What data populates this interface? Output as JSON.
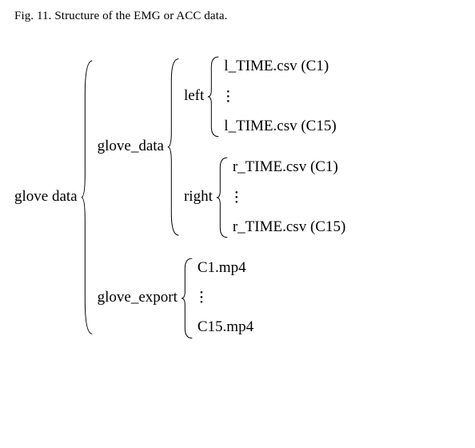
{
  "caption": "Fig. 11.   Structure of the EMG or ACC data.",
  "root": "glove data",
  "branch1": {
    "label": "glove_data",
    "left": {
      "label": "left",
      "first": "l_TIME.csv (C1)",
      "last": "l_TIME.csv (C15)"
    },
    "right": {
      "label": "right",
      "first": "r_TIME.csv (C1)",
      "last": "r_TIME.csv (C15)"
    }
  },
  "branch2": {
    "label": "glove_export",
    "first": "C1.mp4",
    "last": "C15.mp4"
  }
}
